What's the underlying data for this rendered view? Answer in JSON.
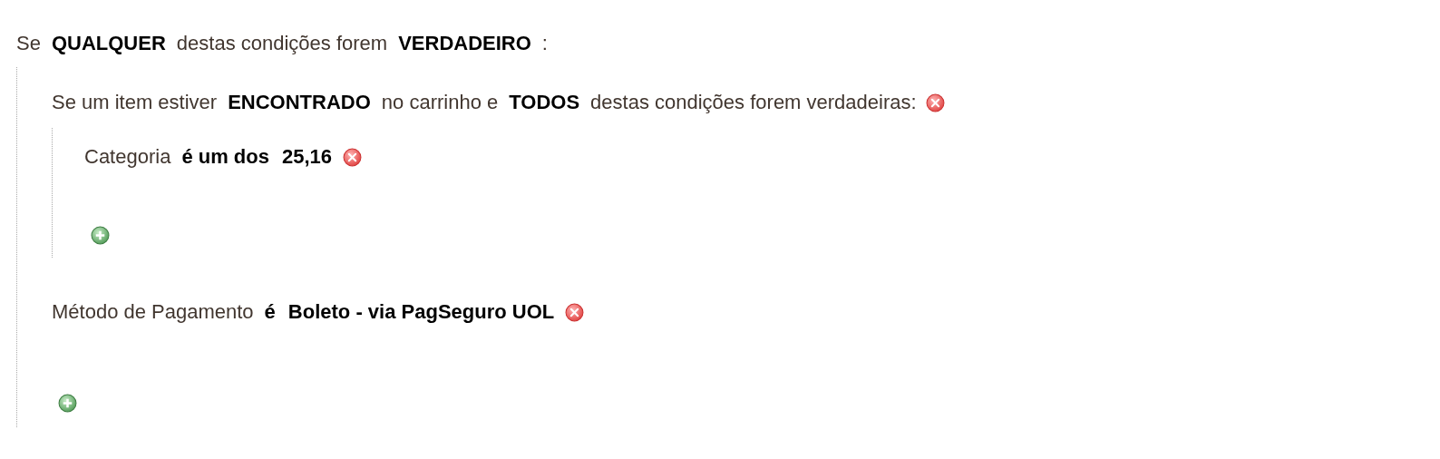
{
  "root": {
    "parts": [
      {
        "kind": "text",
        "text": "Se"
      },
      {
        "kind": "param",
        "text": "QUALQUER"
      },
      {
        "kind": "text",
        "text": "destas condições forem"
      },
      {
        "kind": "param",
        "text": "VERDADEIRO"
      },
      {
        "kind": "text",
        "text": ":"
      }
    ],
    "children": [
      {
        "kind": "combine",
        "parts": [
          {
            "kind": "text",
            "text": "Se um item estiver"
          },
          {
            "kind": "param",
            "text": "ENCONTRADO"
          },
          {
            "kind": "text",
            "text": "no carrinho e"
          },
          {
            "kind": "param",
            "text": "TODOS"
          },
          {
            "kind": "text",
            "text": "destas condições forem verdadeiras:"
          }
        ],
        "children": [
          {
            "kind": "condition",
            "parts": [
              {
                "kind": "text",
                "text": "Categoria"
              },
              {
                "kind": "param",
                "text": "é um dos"
              },
              {
                "kind": "param",
                "text": "25,16"
              }
            ]
          }
        ]
      },
      {
        "kind": "condition",
        "parts": [
          {
            "kind": "text",
            "text": "Método de Pagamento"
          },
          {
            "kind": "param",
            "text": "é"
          },
          {
            "kind": "param",
            "text": "Boleto - via PagSeguro UOL"
          }
        ]
      }
    ]
  }
}
